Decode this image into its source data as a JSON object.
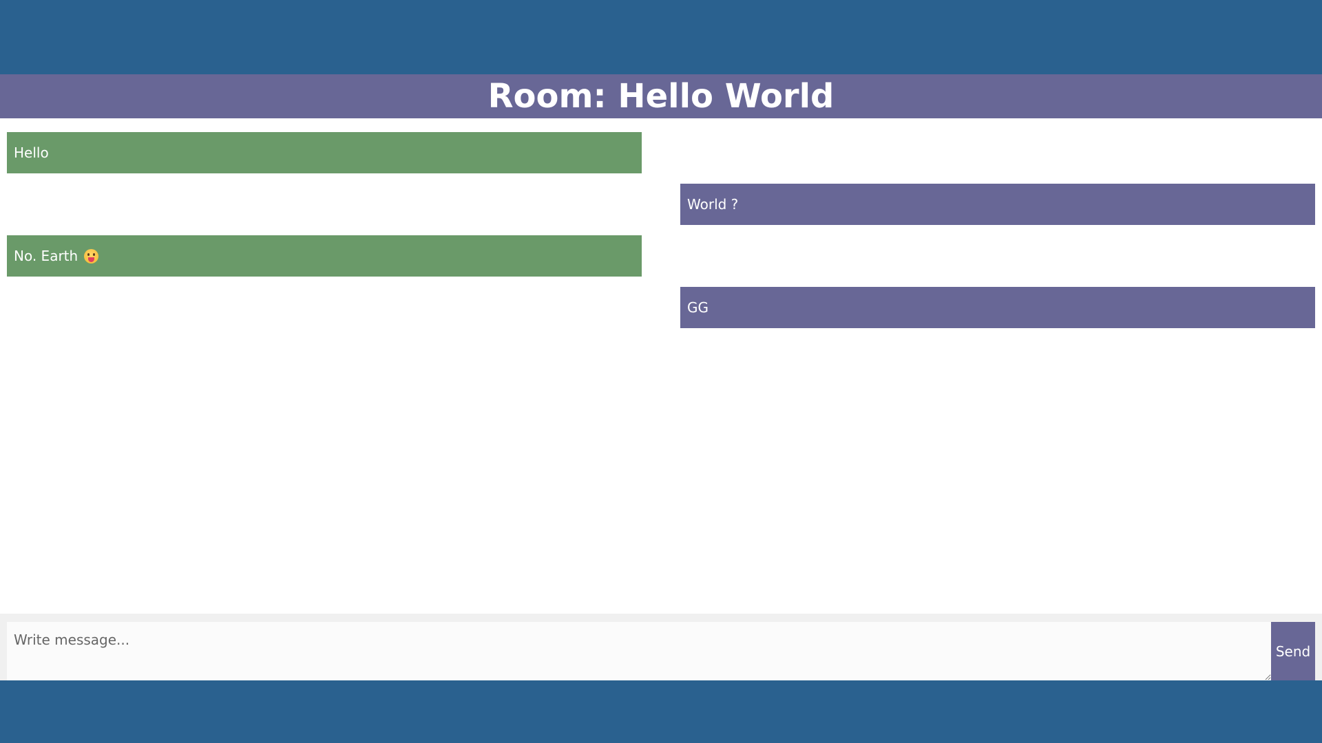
{
  "room": {
    "title": "Room: Hello World"
  },
  "messages": [
    {
      "text": "Hello",
      "side": "sent"
    },
    {
      "text": "World ?",
      "side": "received"
    },
    {
      "text": "No. Earth",
      "side": "sent",
      "emoji": "tongue-out-face-icon"
    },
    {
      "text": "GG",
      "side": "received"
    }
  ],
  "composer": {
    "placeholder": "Write message...",
    "value": "",
    "send_label": "Send"
  },
  "colors": {
    "page_background": "#2a618f",
    "header_background": "#686796",
    "sent_bubble": "#6a9a69",
    "received_bubble": "#686796",
    "send_button": "#686796"
  }
}
